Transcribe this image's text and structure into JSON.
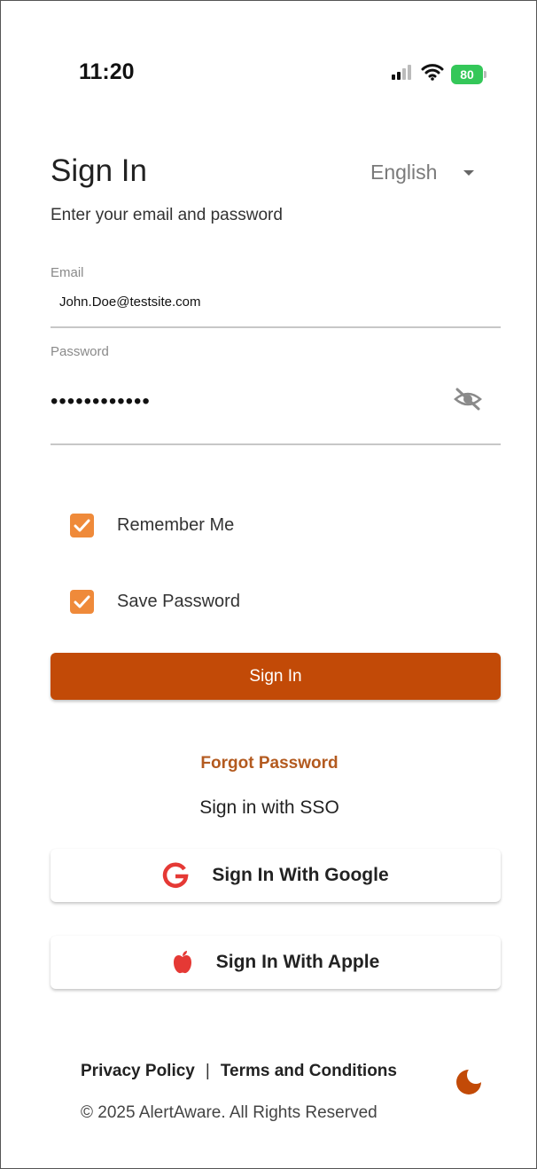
{
  "status_bar": {
    "time": "11:20",
    "battery": "80"
  },
  "header": {
    "title": "Sign In",
    "language": "English",
    "subtitle": "Enter your email and password"
  },
  "form": {
    "email_label": "Email",
    "email_value": "John.Doe@testsite.com",
    "password_label": "Password",
    "password_value": "••••••••••••"
  },
  "options": {
    "remember_me": {
      "label": "Remember Me",
      "checked": true
    },
    "save_password": {
      "label": "Save Password",
      "checked": true
    }
  },
  "actions": {
    "sign_in": "Sign In",
    "forgot_password": "Forgot Password",
    "sso_heading": "Sign in with SSO",
    "google": "Sign In With Google",
    "apple": "Sign In With Apple"
  },
  "footer": {
    "privacy": "Privacy Policy",
    "separator": "|",
    "terms": "Terms and Conditions",
    "copyright": "© 2025 AlertAware. All Rights Reserved"
  },
  "icons": {
    "signal": "signal-icon",
    "wifi": "wifi-icon",
    "battery": "battery-icon",
    "dropdown": "chevron-down-icon",
    "visibility": "eye-off-icon",
    "checkbox": "checkmark-icon",
    "google": "google-icon",
    "apple": "apple-icon",
    "theme": "moon-icon"
  },
  "colors": {
    "primary": "#C24A07",
    "checkbox": "#EF8A3A",
    "link": "#B35A1F",
    "google": "#E53935",
    "apple": "#E53935",
    "battery": "#34C759"
  }
}
